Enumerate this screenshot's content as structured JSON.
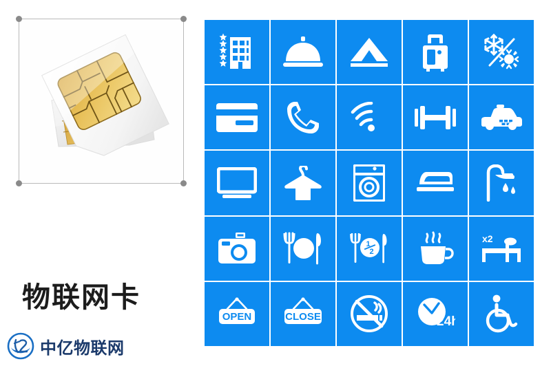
{
  "left_panel": {
    "product_title": "物联网卡",
    "brand_name": "中亿物联网",
    "brand_mark_icon": "circular-logo-icon",
    "image": {
      "name": "sim-card-illustration",
      "selection_frame": "selection-frame",
      "handles": [
        "top-left",
        "top-right",
        "bottom-left",
        "bottom-right"
      ]
    }
  },
  "colors": {
    "tile_blue": "#0d8bf0",
    "tile_icon": "#ffffff",
    "title_text": "#1c1c1c",
    "brand_text": "#1b3a6b",
    "frame_line": "#b9b9b9",
    "handle": "#8a8a8a",
    "page_background": "#ffffff"
  },
  "icon_grid": {
    "columns": 5,
    "rows": 5,
    "tiles": [
      {
        "icon": "hotel-stars-icon",
        "label": "5-Star Hotel"
      },
      {
        "icon": "room-service-icon",
        "label": "Room Service"
      },
      {
        "icon": "tent-icon",
        "label": "Camping"
      },
      {
        "icon": "luggage-icon",
        "label": "Luggage Storage"
      },
      {
        "icon": "air-conditioning-icon",
        "label": "Air Conditioning"
      },
      {
        "icon": "credit-card-icon",
        "label": "Credit Card"
      },
      {
        "icon": "telephone-icon",
        "label": "Telephone"
      },
      {
        "icon": "wifi-icon",
        "label": "Wi-Fi"
      },
      {
        "icon": "dumbbell-icon",
        "label": "Gym"
      },
      {
        "icon": "taxi-icon",
        "label": "Taxi"
      },
      {
        "icon": "television-icon",
        "label": "Television"
      },
      {
        "icon": "clothes-hanger-icon",
        "label": "Laundry Service"
      },
      {
        "icon": "washing-machine-icon",
        "label": "Washing Machine"
      },
      {
        "icon": "iron-icon",
        "label": "Ironing"
      },
      {
        "icon": "shower-icon",
        "label": "Shower"
      },
      {
        "icon": "camera-icon",
        "label": "Camera"
      },
      {
        "icon": "restaurant-icon",
        "label": "Restaurant"
      },
      {
        "icon": "half-board-icon",
        "label": "Half Board",
        "text": "1/2"
      },
      {
        "icon": "coffee-cup-icon",
        "label": "Coffee"
      },
      {
        "icon": "double-bed-icon",
        "label": "Double Bed",
        "text": "x2"
      },
      {
        "icon": "open-sign-icon",
        "label": "Open",
        "text": "OPEN"
      },
      {
        "icon": "close-sign-icon",
        "label": "Closed",
        "text": "CLOSE"
      },
      {
        "icon": "no-smoking-icon",
        "label": "No Smoking"
      },
      {
        "icon": "clock-24h-icon",
        "label": "24 Hours",
        "text": "24h"
      },
      {
        "icon": "wheelchair-icon",
        "label": "Accessible"
      }
    ]
  }
}
